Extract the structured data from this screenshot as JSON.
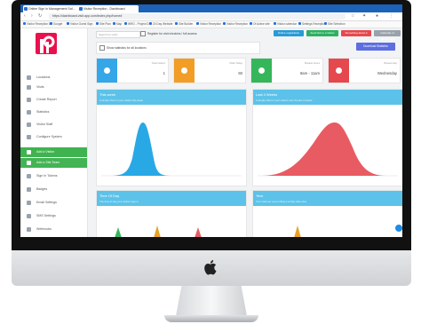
{
  "browser": {
    "tabs": [
      {
        "label": "Online Sign In Management Sof..."
      },
      {
        "label": "Visitor Reception - Dashboard"
      }
    ],
    "new_tab_label": "+",
    "url": "https://dashboard.visit.app.com/index.php/home#",
    "bookmarks": [
      "Visitor Reception 1",
      "Google",
      "Visitor Guest Sign",
      "Site Plan",
      "Map",
      "WRG - Project D",
      "20 Day Website",
      "Site Builder",
      "Visitor Reception",
      "Visitor Reception",
      "Of Active site",
      "Visitor calendar",
      "Settings Receptio",
      "Site Selection"
    ]
  },
  "sidebar": {
    "items": [
      {
        "label": "Locations"
      },
      {
        "label": "Visits"
      },
      {
        "label": "Create Report"
      },
      {
        "label": "Statistics"
      },
      {
        "label": "Visitor Staff"
      },
      {
        "label": "Configure System"
      },
      {
        "label": "Add a Visitor"
      },
      {
        "label": "Add a Site Team"
      },
      {
        "label": "Sign In Tokens"
      },
      {
        "label": "Badges"
      },
      {
        "label": "Email Settings"
      },
      {
        "label": "SMS Settings"
      },
      {
        "label": "Webhooks"
      }
    ]
  },
  "toolbar": {
    "search_placeholder": "Search for visits",
    "register_label": "Register for visit checkins / full access",
    "buttons": [
      {
        "label": "Online registration",
        "color": "#2a9bd6"
      },
      {
        "label": "Send link to a Visitor",
        "color": "#2eb160"
      },
      {
        "label": "Something about it",
        "color": "#e5484d"
      },
      {
        "label": "Calendar of Appointments",
        "color": "#9aa2ab"
      }
    ]
  },
  "filter": {
    "label": "Show statistics for all locations",
    "button_label": "Download Statistics"
  },
  "stats": [
    {
      "title": "Total visitors",
      "value": "1",
      "color": "#35a6e8"
    },
    {
      "title": "Visits Today",
      "value": "60",
      "color": "#f29d26"
    },
    {
      "title": "Busiest hours",
      "value": "8am - 11am",
      "color": "#35b65a"
    },
    {
      "title": "Busiest day",
      "value": "Wednesday",
      "color": "#e5484d"
    }
  ],
  "panels": [
    {
      "title": "This week",
      "subtitle": "A simple chart of your visitors this week",
      "color": "#29a8e6"
    },
    {
      "title": "Last 4 Weeks",
      "subtitle": "A simple chart of your visitors over the last 4 weeks",
      "color": "#e85b62"
    },
    {
      "title": "Time Of Day",
      "subtitle": "The time of day your visitors sign in",
      "color": "#35b65a"
    },
    {
      "title": "Year",
      "subtitle": "Your visits per year (rolling monthly) data view",
      "color": "#f29d26"
    }
  ]
}
